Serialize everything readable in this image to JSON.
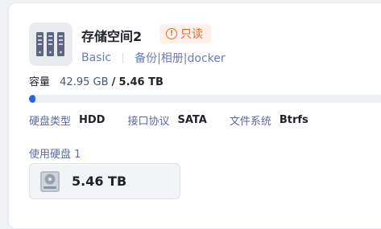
{
  "storage": {
    "name": "存储空间2",
    "badge": "只读",
    "raid_type": "Basic",
    "tags": "备份|相册|docker"
  },
  "capacity": {
    "label": "容量",
    "used": "42.95 GB",
    "separator": "/",
    "total": "5.46 TB",
    "fraction_used": 0.008
  },
  "specs": [
    {
      "label": "硬盘类型",
      "value": "HDD"
    },
    {
      "label": "接口协议",
      "value": "SATA"
    },
    {
      "label": "文件系统",
      "value": "Btrfs"
    }
  ],
  "disks": {
    "label": "使用硬盘 1",
    "items": [
      {
        "size": "5.46 TB"
      }
    ]
  },
  "colors": {
    "accent": "#2563eb",
    "badge_text": "#e46a2c",
    "badge_bg": "#fdf1ea"
  }
}
